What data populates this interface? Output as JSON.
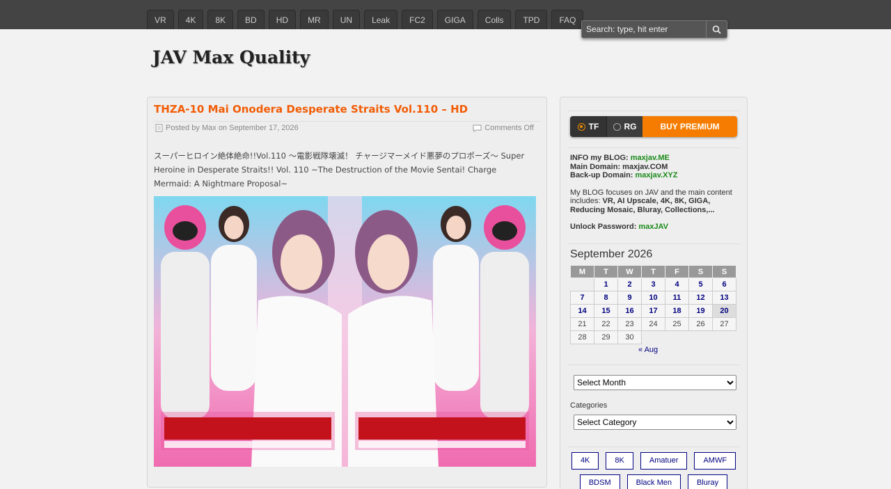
{
  "nav": [
    "VR",
    "4K",
    "8K",
    "BD",
    "HD",
    "MR",
    "UN",
    "Leak",
    "FC2",
    "GIGA",
    "Colls",
    "TPD",
    "FAQ"
  ],
  "search": {
    "placeholder": "Search: type, hit enter",
    "button_icon": "search-icon"
  },
  "site_title": "JAV Max Quality",
  "post": {
    "title": "THZA-10 Mai Onodera Desperate Straits Vol.110 – HD",
    "meta": "Posted by Max on September 17, 2026",
    "comments": "Comments Off",
    "description": "スーパーヒロイン絶体絶命!!Vol.110 ～電影戦隊壊滅！ チャージマーメイド悪夢のプロポーズ～ Super Heroine in Desperate Straits!! Vol. 110 ~The Destruction of the Movie Sentai! Charge Mermaid: A Nightmare Proposal~",
    "cover_alt": "cover image"
  },
  "sidebar": {
    "toggle": {
      "tf": "TF",
      "rg": "RG",
      "buy": "BUY PREMIUM"
    },
    "info": {
      "blog_label": "INFO my BLOG: ",
      "blog_link": "maxjav.ME",
      "main_label": "Main Domain: maxjav.COM",
      "backup_label": "Back-up Domain: ",
      "backup_link": "maxjav.XYZ",
      "focus_pre": "My BLOG focuses on JAV and the main content includes: ",
      "focus_bold": "VR, AI Upscale, 4K, 8K, GIGA, Reducing Mosaic, Bluray, Collections,...",
      "unlock_label": "Unlock Password: ",
      "unlock_value": "maxJAV"
    },
    "calendar": {
      "title": "September 2026",
      "headers": [
        "M",
        "T",
        "W",
        "T",
        "F",
        "S",
        "S"
      ],
      "rows": [
        [
          "",
          "1",
          "2",
          "3",
          "4",
          "5",
          "6"
        ],
        [
          "7",
          "8",
          "9",
          "10",
          "11",
          "12",
          "13"
        ],
        [
          "14",
          "15",
          "16",
          "17",
          "18",
          "19",
          "20"
        ],
        [
          "21",
          "22",
          "23",
          "24",
          "25",
          "26",
          "27"
        ],
        [
          "28",
          "29",
          "30",
          "",
          "",
          "",
          ""
        ]
      ],
      "linked_days": [
        "1",
        "2",
        "3",
        "4",
        "5",
        "6",
        "7",
        "8",
        "9",
        "10",
        "11",
        "12",
        "13",
        "14",
        "15",
        "16",
        "17",
        "18",
        "19",
        "20"
      ],
      "prev": "« Aug"
    },
    "archive_select": "Select Month",
    "categories_label": "Categories",
    "category_select": "Select Category",
    "tags": [
      "4K",
      "8K",
      "Amatuer",
      "AMWF",
      "BDSM",
      "Black Men",
      "Bluray"
    ]
  }
}
